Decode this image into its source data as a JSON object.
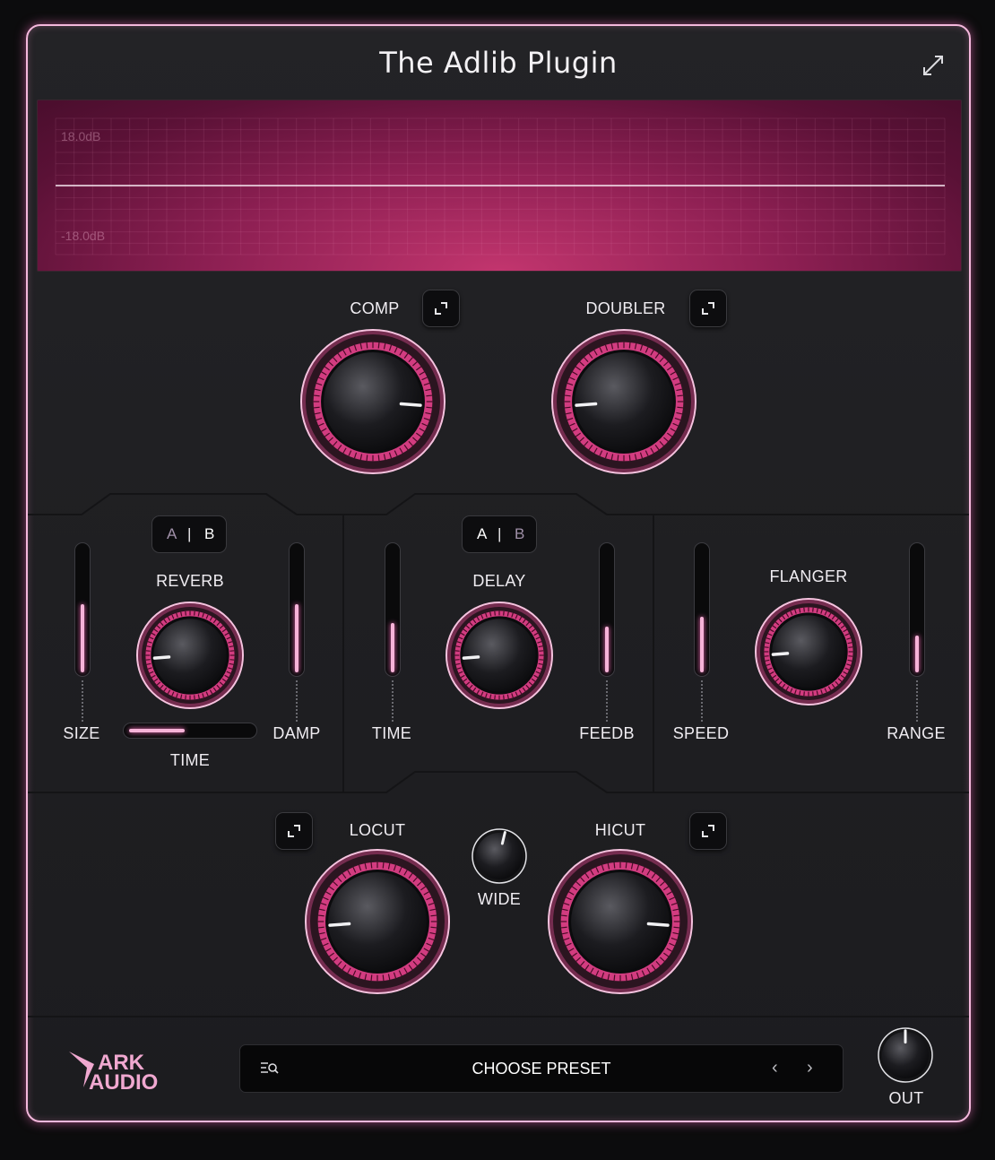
{
  "window": {
    "title": "The Adlib Plugin"
  },
  "scope": {
    "db_top": "18.0dB",
    "db_bottom": "-18.0dB"
  },
  "colors": {
    "accent": "#f4b8dc",
    "glow": "#ff5fb3",
    "scope_center": "#c2356e"
  },
  "comp": {
    "label": "COMP",
    "value": 0.85
  },
  "doubler": {
    "label": "DOUBLER",
    "value": 0.15
  },
  "reverb": {
    "label": "REVERB",
    "ab_a": "A",
    "ab_sep": "|",
    "ab_b": "B",
    "ab_active": "B",
    "value": 0.15,
    "size": {
      "label": "SIZE",
      "value": 0.55
    },
    "damp": {
      "label": "DAMP",
      "value": 0.55
    },
    "time": {
      "label": "TIME",
      "value": 0.45
    }
  },
  "delay": {
    "label": "DELAY",
    "ab_a": "A",
    "ab_sep": "|",
    "ab_b": "B",
    "ab_active": "A",
    "value": 0.15,
    "time": {
      "label": "TIME",
      "value": 0.4
    },
    "feedb": {
      "label": "FEEDB",
      "value": 0.37
    }
  },
  "flanger": {
    "label": "FLANGER",
    "value": 0.15,
    "speed": {
      "label": "SPEED",
      "value": 0.45
    },
    "range": {
      "label": "RANGE",
      "value": 0.3
    }
  },
  "locut": {
    "label": "LOCUT",
    "value": 0.15
  },
  "hicut": {
    "label": "HICUT",
    "value": 0.85
  },
  "wide": {
    "label": "WIDE",
    "value": 0.55
  },
  "out": {
    "label": "OUT",
    "value": 0.5
  },
  "preset": {
    "label": "CHOOSE PRESET",
    "prev": "‹",
    "next": "›"
  },
  "logo": {
    "line1": "ARK",
    "line2": "AUDIO"
  }
}
